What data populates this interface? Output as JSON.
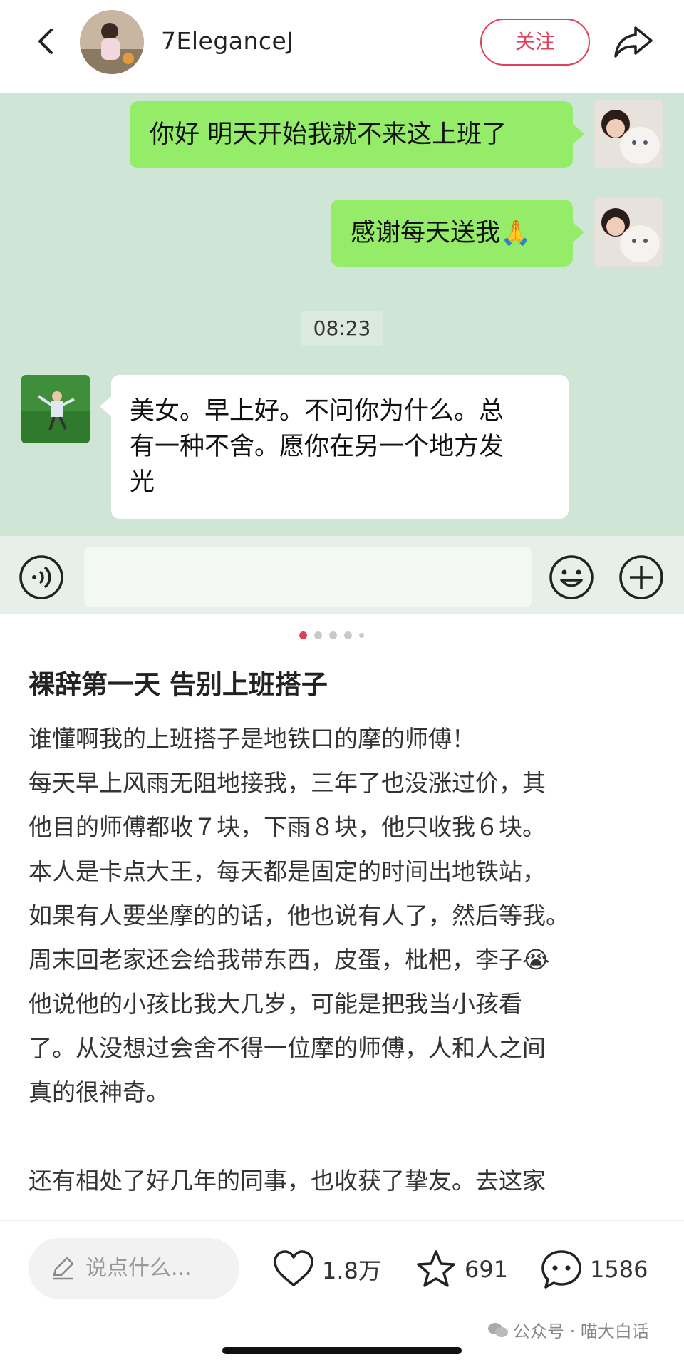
{
  "header": {
    "username": "7EleganceJ",
    "follow_label": "关注"
  },
  "chat": {
    "messages_right": [
      {
        "text": "你好 明天开始我就不来这上班了"
      },
      {
        "text": "感谢每天送我🙏"
      }
    ],
    "timestamp": "08:23",
    "message_left": {
      "lines": [
        "美女。早上好。不问你为什么。总",
        "有一种不舍。愿你在另一个地方发",
        "光"
      ]
    }
  },
  "post": {
    "title": "裸辞第一天 告别上班搭子",
    "lines": [
      "谁懂啊我的上班搭子是地铁口的摩的师傅！",
      "每天早上风雨无阻地接我，三年了也没涨过价，其",
      "他目的师傅都收７块，下雨８块，他只收我６块。",
      "本人是卡点大王，每天都是固定的时间出地铁站，",
      "如果有人要坐摩的的话，他也说有人了，然后等我。",
      "周末回老家还会给我带东西，皮蛋，枇杷，李子😭",
      "他说他的小孩比我大几岁，可能是把我当小孩看",
      "了。从没想过会舍不得一位摩的师傅，人和人之间",
      "真的很神奇。",
      "",
      "还有相处了好几年的同事，也收获了挚友。去这家"
    ]
  },
  "bottom": {
    "comment_placeholder": "说点什么...",
    "likes": "1.8万",
    "favorites": "691",
    "comments": "1586"
  },
  "watermark": "公众号 · 喵大白话",
  "colors": {
    "accent": "#e0405a",
    "chat_bg": "#cfe6d6",
    "bubble_green": "#95ec69"
  }
}
